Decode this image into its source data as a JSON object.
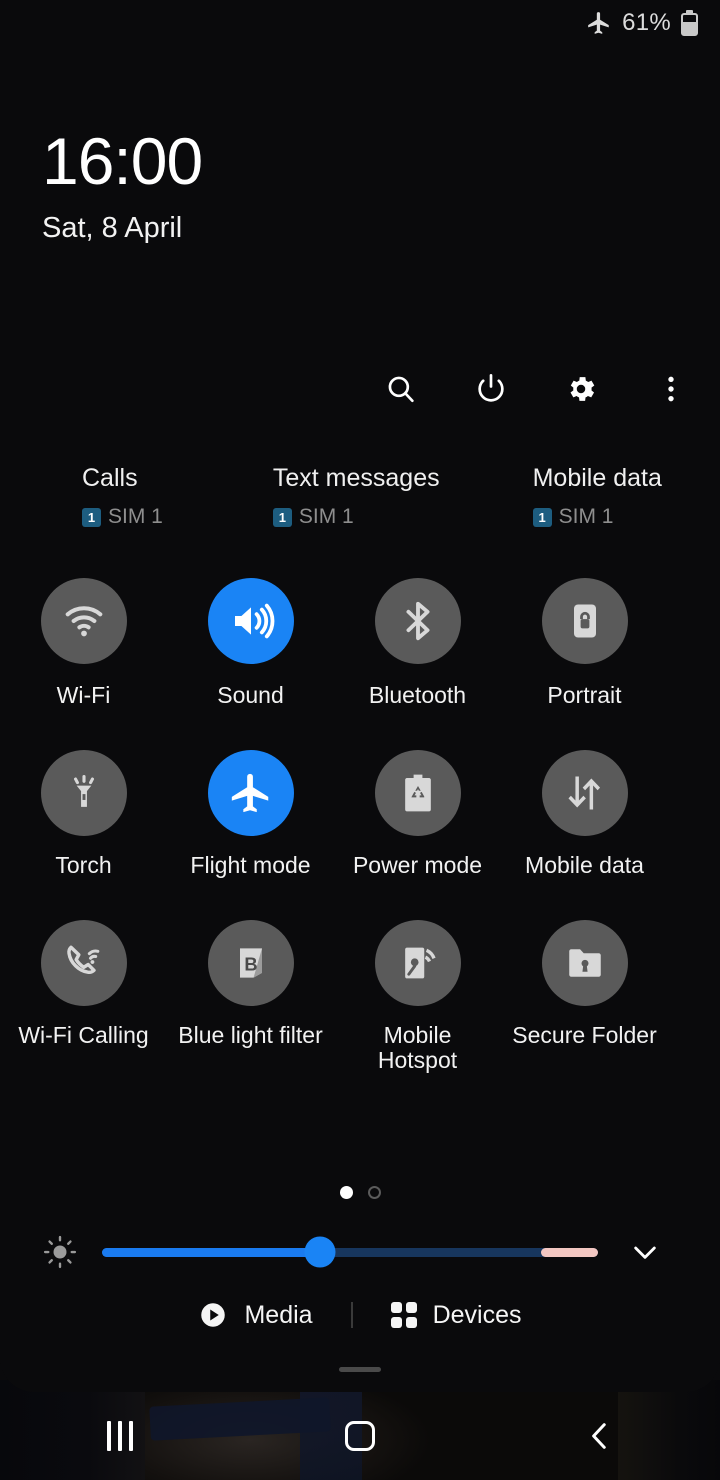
{
  "status_bar": {
    "airplane_icon": "airplane-icon",
    "battery_percent": "61%",
    "battery_icon": "battery-icon"
  },
  "clock": {
    "time": "16:00",
    "date": "Sat, 8 April"
  },
  "header_actions": [
    {
      "name": "search-icon",
      "label": "Search"
    },
    {
      "name": "power-icon",
      "label": "Power"
    },
    {
      "name": "gear-icon",
      "label": "Settings"
    },
    {
      "name": "more-vertical-icon",
      "label": "More options"
    }
  ],
  "sim_status": [
    {
      "title": "Calls",
      "badge": "1",
      "sim": "SIM 1"
    },
    {
      "title": "Text messages",
      "badge": "1",
      "sim": "SIM 1"
    },
    {
      "title": "Mobile data",
      "badge": "1",
      "sim": "SIM 1"
    }
  ],
  "tiles": {
    "row1": [
      {
        "label": "Wi-Fi",
        "icon": "wifi-icon",
        "active": false
      },
      {
        "label": "Sound",
        "icon": "volume-icon",
        "active": true
      },
      {
        "label": "Bluetooth",
        "icon": "bluetooth-icon",
        "active": false
      },
      {
        "label": "Portrait",
        "icon": "rotation-lock-icon",
        "active": false
      }
    ],
    "row2": [
      {
        "label": "Torch",
        "icon": "flashlight-icon",
        "active": false
      },
      {
        "label": "Flight mode",
        "icon": "airplane-icon",
        "active": true
      },
      {
        "label": "Power mode",
        "icon": "power-saving-icon",
        "active": false
      },
      {
        "label": "Mobile data",
        "icon": "data-arrows-icon",
        "active": false
      }
    ],
    "row3": [
      {
        "label": "Wi-Fi Calling",
        "icon": "wifi-calling-icon",
        "active": false
      },
      {
        "label": "Blue light filter",
        "icon": "blue-light-filter-icon",
        "active": false
      },
      {
        "label": "Mobile Hotspot",
        "icon": "hotspot-icon",
        "active": false
      },
      {
        "label": "Secure Folder",
        "icon": "secure-folder-icon",
        "active": false
      }
    ]
  },
  "pagination": {
    "pages": 2,
    "current": 1
  },
  "brightness": {
    "icon": "brightness-icon",
    "value_percent": 44,
    "expand_icon": "chevron-down-icon"
  },
  "footer": {
    "media_label": "Media",
    "media_icon": "play-circle-icon",
    "devices_label": "Devices",
    "devices_icon": "devices-grid-icon"
  },
  "navigation": {
    "recents": "recents-button",
    "home": "home-button",
    "back": "back-button"
  },
  "colors": {
    "accent_blue": "#1a84f5",
    "tile_off": "#5a5a5a",
    "panel_bg": "#0a0a0c",
    "slider_track": "#17365e",
    "slider_pink": "#f3c7c2",
    "badge_blue": "#1d5d80"
  }
}
